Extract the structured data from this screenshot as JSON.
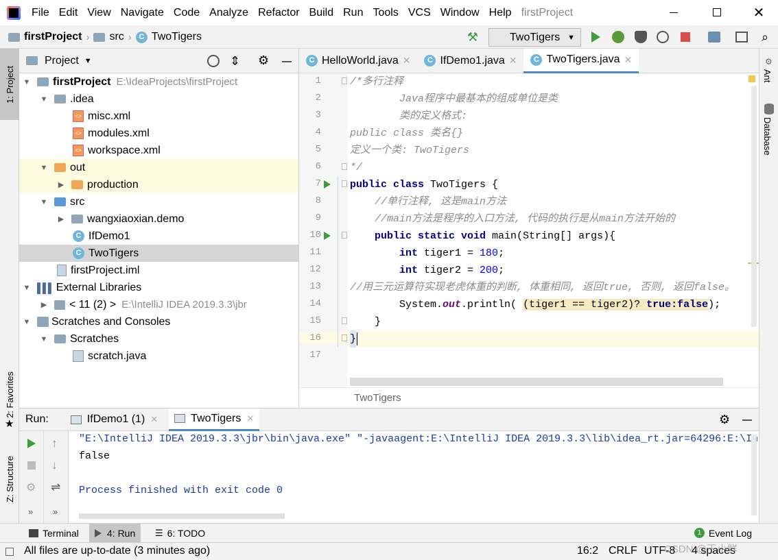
{
  "menu": {
    "items": [
      "File",
      "Edit",
      "View",
      "Navigate",
      "Code",
      "Analyze",
      "Refactor",
      "Build",
      "Run",
      "Tools",
      "VCS",
      "Window",
      "Help"
    ],
    "project_name": "firstProject"
  },
  "navbar": {
    "crumb_project": "firstProject",
    "crumb_src": "src",
    "crumb_class": "TwoTigers",
    "run_config": "TwoTigers"
  },
  "left_stripe": {
    "project": "1: Project",
    "favorites": "2: Favorites",
    "structure": "Z: Structure"
  },
  "right_stripe": {
    "ant": "Ant",
    "database": "Database"
  },
  "project_panel": {
    "title": "Project",
    "tree": [
      {
        "label": "firstProject",
        "path": "E:\\IdeaProjects\\firstProject"
      },
      {
        "label": ".idea"
      },
      {
        "label": "misc.xml"
      },
      {
        "label": "modules.xml"
      },
      {
        "label": "workspace.xml"
      },
      {
        "label": "out"
      },
      {
        "label": "production"
      },
      {
        "label": "src"
      },
      {
        "label": "wangxiaoxian.demo"
      },
      {
        "label": "IfDemo1"
      },
      {
        "label": "TwoTigers"
      },
      {
        "label": "firstProject.iml"
      },
      {
        "label": "External Libraries"
      },
      {
        "label": "< 11 (2) >",
        "path": "E:\\IntelliJ IDEA 2019.3.3\\jbr"
      },
      {
        "label": "Scratches and Consoles"
      },
      {
        "label": "Scratches"
      },
      {
        "label": "scratch.java"
      }
    ]
  },
  "editor": {
    "tabs": [
      "HelloWorld.java",
      "IfDemo1.java",
      "TwoTigers.java"
    ],
    "line_numbers": [
      "1",
      "2",
      "3",
      "4",
      "5",
      "6",
      "7",
      "8",
      "9",
      "10",
      "11",
      "12",
      "13",
      "14",
      "15",
      "16",
      "17"
    ],
    "lines": {
      "l1": "/*多行注释",
      "l2": "        Java程序中最基本的组成单位是类",
      "l3": "        类的定义格式:",
      "l4": "public class 类名{}",
      "l5": "定义一个类: TwoTigers",
      "l6": "*/",
      "l7_kw": "public class",
      "l7_rest": " TwoTigers {",
      "l8": "    //单行注释, 这是main方法",
      "l9": "    //main方法是程序的入口方法, 代码的执行是从main方法开始的",
      "l10_kw": "    public static void",
      "l10_rest": " main(String[] args){",
      "l11_kw": "        int",
      "l11_mid": " tiger1 = ",
      "l11_num": "180",
      "l11_end": ";",
      "l12_kw": "        int",
      "l12_mid": " tiger2 = ",
      "l12_num": "200",
      "l12_end": ";",
      "l13": "//用三元运算符实现老虎体重的判断, 体重相同, 返回true, 否则, 返回false。",
      "l14_a": "        System.",
      "l14_out": "out",
      "l14_b": ".println( ",
      "l14_expr": "(tiger1 == tiger2)? ",
      "l14_true": "true",
      "l14_colon": ":",
      "l14_false": "false",
      "l14_end": ");",
      "l15": "    }",
      "l16": "}"
    },
    "breadcrumb": "TwoTigers"
  },
  "run": {
    "label": "Run:",
    "tabs": [
      "IfDemo1 (1)",
      "TwoTigers"
    ],
    "console": [
      "\"E:\\IntelliJ IDEA 2019.3.3\\jbr\\bin\\java.exe\" \"-javaagent:E:\\IntelliJ IDEA 2019.3.3\\lib\\idea_rt.jar=64296:E:\\In",
      "false",
      "",
      "Process finished with exit code 0"
    ]
  },
  "toolwindows": {
    "terminal": "Terminal",
    "run": "4: Run",
    "todo": "6: TODO",
    "event_log": "Event Log"
  },
  "status": {
    "message": "All files are up-to-date (3 minutes ago)",
    "position": "16:2",
    "line_sep": "CRLF",
    "encoding": "UTF-8",
    "indent": "4 spaces",
    "watermark": "CSDN @王小鲜"
  },
  "colors": {
    "accent": "#4a88c7",
    "selected_row": "#d5d5d5",
    "highlight_row": "#fdfbe0",
    "current_line": "#fffae3"
  }
}
